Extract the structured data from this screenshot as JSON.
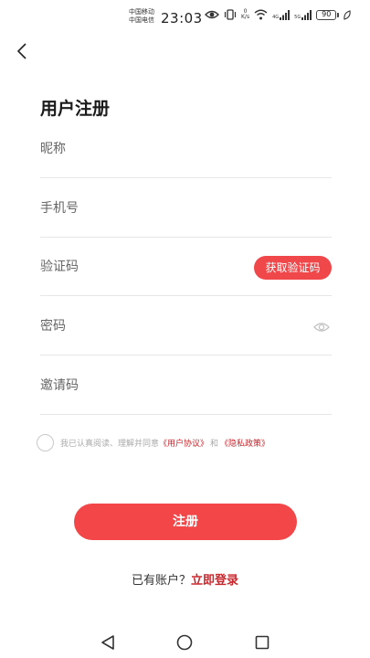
{
  "status_bar": {
    "carrier_1": "中国移动",
    "carrier_2": "中国电信",
    "time": "23:03",
    "speed_value": "0",
    "speed_unit": "K/s",
    "network_1": "4G",
    "network_2": "5G",
    "battery": "90"
  },
  "header": {
    "title": "用户注册"
  },
  "form": {
    "nickname_placeholder": "昵称",
    "phone_placeholder": "手机号",
    "code_placeholder": "验证码",
    "get_code_label": "获取验证码",
    "password_placeholder": "密码",
    "invite_placeholder": "邀请码"
  },
  "agreement": {
    "prefix": "我已认真阅读、理解并同意",
    "user_agreement": "《用户协议》",
    "conjunction": "和",
    "privacy_policy": "《隐私政策》"
  },
  "actions": {
    "register_label": "注册",
    "login_prompt": "已有账户？",
    "login_link": "立即登录"
  },
  "colors": {
    "accent": "#f24649",
    "link": "#c8272d"
  }
}
